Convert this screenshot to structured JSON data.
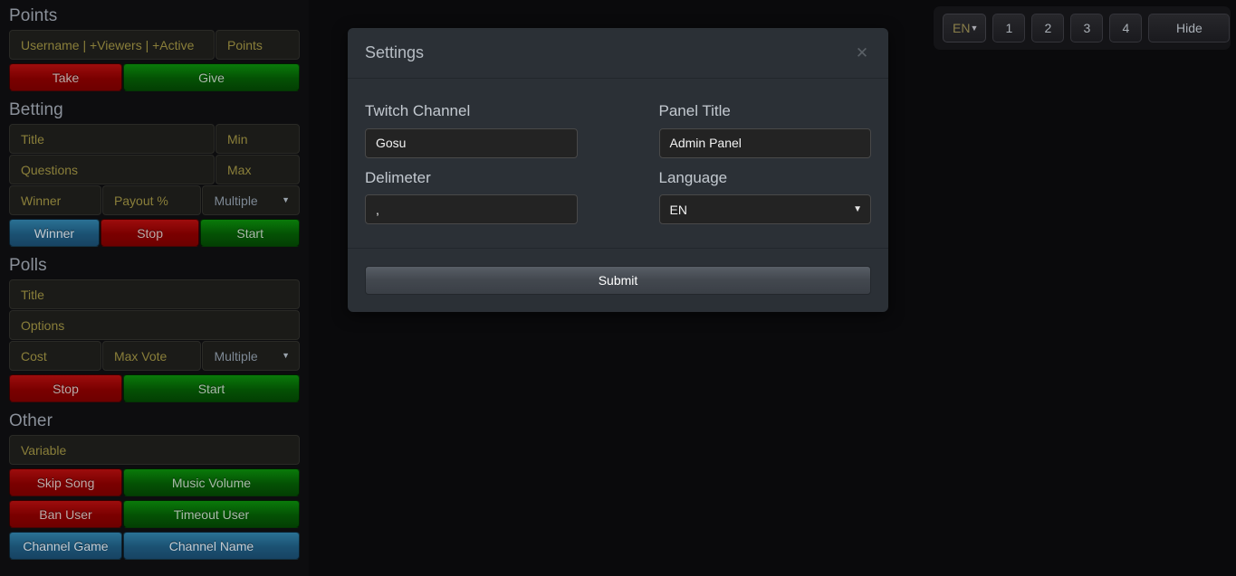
{
  "sidebar": {
    "sections": [
      {
        "heading": "Points",
        "inputs": [
          {
            "placeholder": "Username | +Viewers | +Active",
            "flex": 3
          },
          {
            "placeholder": "Points",
            "flex": 1
          }
        ],
        "buttons": [
          {
            "label": "Take",
            "color": "red"
          },
          {
            "label": "Give",
            "color": "green"
          }
        ]
      },
      {
        "heading": "Betting",
        "row1": [
          {
            "placeholder": "Title",
            "flex": 3
          },
          {
            "placeholder": "Min",
            "flex": 1
          }
        ],
        "row2": [
          {
            "placeholder": "Questions",
            "flex": 3
          },
          {
            "placeholder": "Max",
            "flex": 1
          }
        ],
        "row3": [
          {
            "placeholder": "Winner",
            "flex": 1
          },
          {
            "placeholder": "Payout %",
            "flex": 1
          },
          {
            "placeholder": "Multiple",
            "flex": 1,
            "select": true
          }
        ],
        "buttons": [
          {
            "label": "Winner",
            "color": "blue"
          },
          {
            "label": "Stop",
            "color": "red"
          },
          {
            "label": "Start",
            "color": "green"
          }
        ]
      },
      {
        "heading": "Polls",
        "row1": [
          {
            "placeholder": "Title",
            "flex": 1
          }
        ],
        "row2": [
          {
            "placeholder": "Options",
            "flex": 1
          }
        ],
        "row3": [
          {
            "placeholder": "Cost",
            "flex": 1
          },
          {
            "placeholder": "Max Vote",
            "flex": 1
          },
          {
            "placeholder": "Multiple",
            "flex": 1,
            "select": true
          }
        ],
        "buttons": [
          {
            "label": "Stop",
            "color": "red"
          },
          {
            "label": "Start",
            "color": "green"
          }
        ]
      },
      {
        "heading": "Other",
        "row1": [
          {
            "placeholder": "Variable",
            "flex": 1
          }
        ],
        "buttonRows": [
          [
            {
              "label": "Skip Song",
              "color": "red"
            },
            {
              "label": "Music Volume",
              "color": "green"
            }
          ],
          [
            {
              "label": "Ban User",
              "color": "red"
            },
            {
              "label": "Timeout User",
              "color": "green"
            }
          ],
          [
            {
              "label": "Channel Game",
              "color": "blue"
            },
            {
              "label": "Channel Name",
              "color": "blue"
            }
          ]
        ]
      }
    ]
  },
  "toolbar": {
    "language_value": "EN",
    "caret": "▼",
    "page_buttons": [
      "1",
      "2",
      "3",
      "4"
    ],
    "hide_label": "Hide"
  },
  "modal": {
    "title": "Settings",
    "close_icon": "✕",
    "fields": {
      "twitch_channel_label": "Twitch Channel",
      "twitch_channel_value": "Gosu",
      "panel_title_label": "Panel Title",
      "panel_title_value": "Admin Panel",
      "delimeter_label": "Delimeter",
      "delimeter_value": ",",
      "language_label": "Language",
      "language_value": "EN",
      "caret": "▼"
    },
    "submit_label": "Submit"
  },
  "colors": {
    "page_background": "#0a0a0c",
    "sidebar_background": "#0d0d0f",
    "modal_background": "#2b3036",
    "accent_red": "#7a0000",
    "accent_green": "#045104",
    "accent_blue": "#1b5172",
    "placeholder_text": "#8a7f3a",
    "heading_text": "#8a9099"
  }
}
